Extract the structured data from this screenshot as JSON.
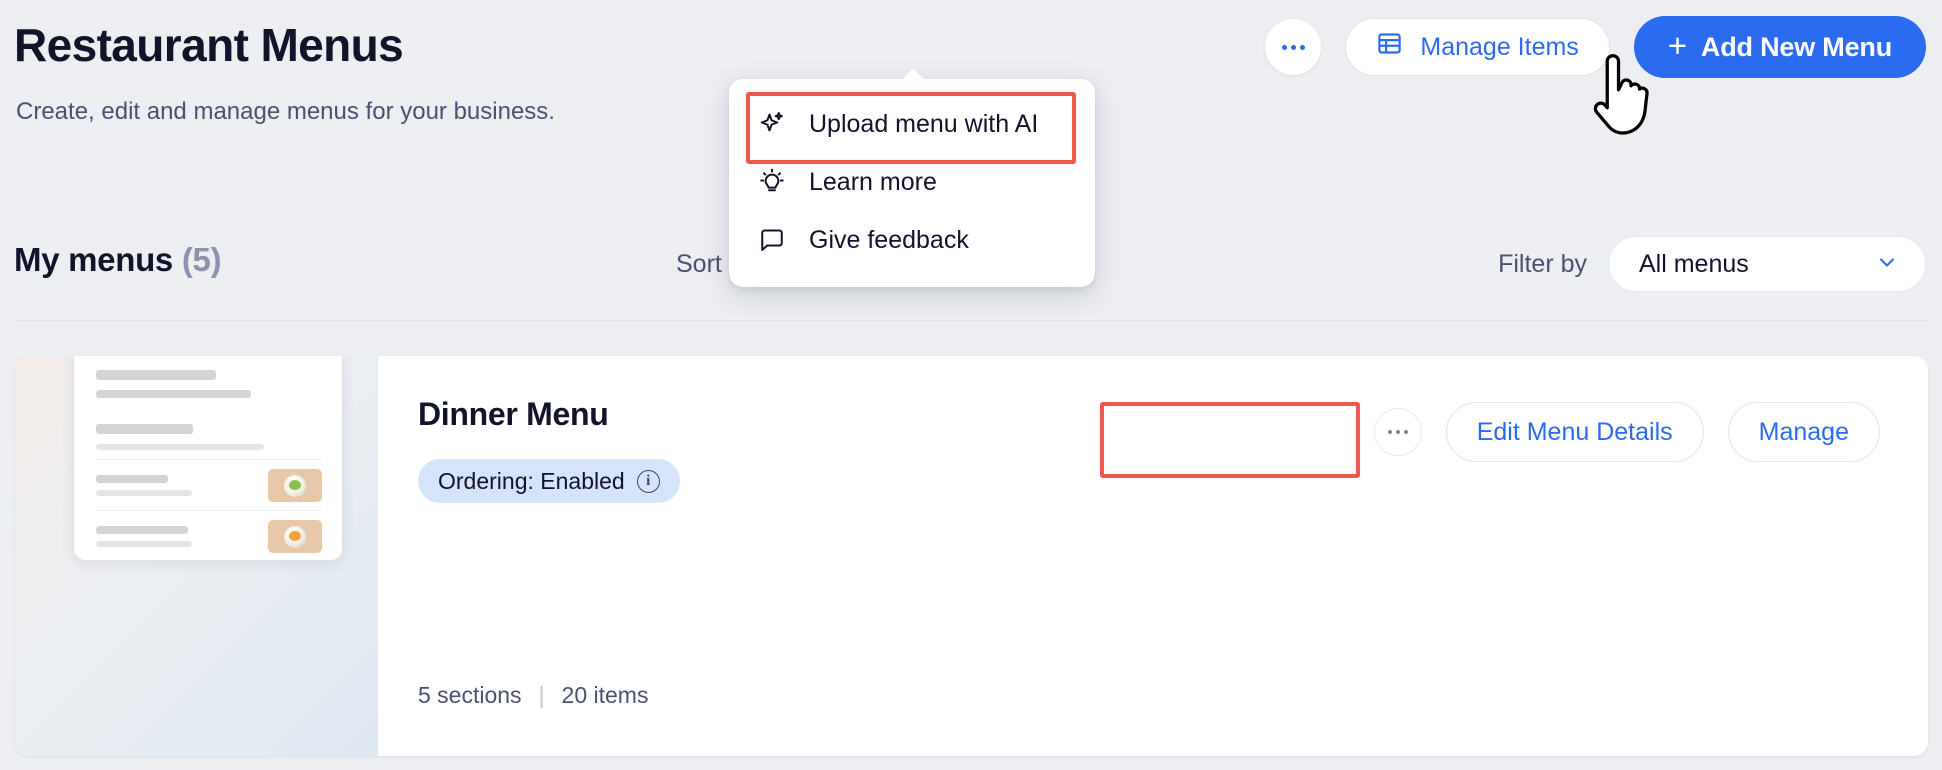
{
  "header": {
    "title": "Restaurant Menus",
    "subtitle": "Create, edit and manage menus for your business.",
    "more_icon": "ellipsis-icon",
    "manage_items_label": "Manage Items",
    "manage_items_icon": "table-grid-icon",
    "add_menu_label": "Add New Menu",
    "add_menu_icon": "plus-icon"
  },
  "dropdown": {
    "items": [
      {
        "label": "Upload menu with AI",
        "icon": "sparkle-ai-icon",
        "highlighted": true
      },
      {
        "label": "Learn more",
        "icon": "lightbulb-icon",
        "highlighted": false
      },
      {
        "label": "Give feedback",
        "icon": "speech-bubble-icon",
        "highlighted": false
      }
    ]
  },
  "toolbar": {
    "section_title": "My menus",
    "section_count": "(5)",
    "sort_label": "Sort",
    "filter_label": "Filter by",
    "filter_value": "All menus",
    "filter_chevron": "chevron-down-icon"
  },
  "menu_card": {
    "name": "Dinner Menu",
    "badge_text": "Ordering: Enabled",
    "badge_info_icon": "info-icon",
    "sections_text": "5 sections",
    "separator": "|",
    "items_text": "20 items",
    "more_icon": "ellipsis-icon",
    "edit_label": "Edit Menu Details",
    "manage_label": "Manage",
    "thumbnail_name": "menu-preview-thumbnail"
  },
  "colors": {
    "accent_blue": "#2b6bf0",
    "highlight_red": "#f2584a",
    "badge_blue": "#d5e3fb",
    "page_bg": "#eceef1",
    "title_ink": "#11142b"
  },
  "cursor": {
    "type": "pointing-hand"
  }
}
